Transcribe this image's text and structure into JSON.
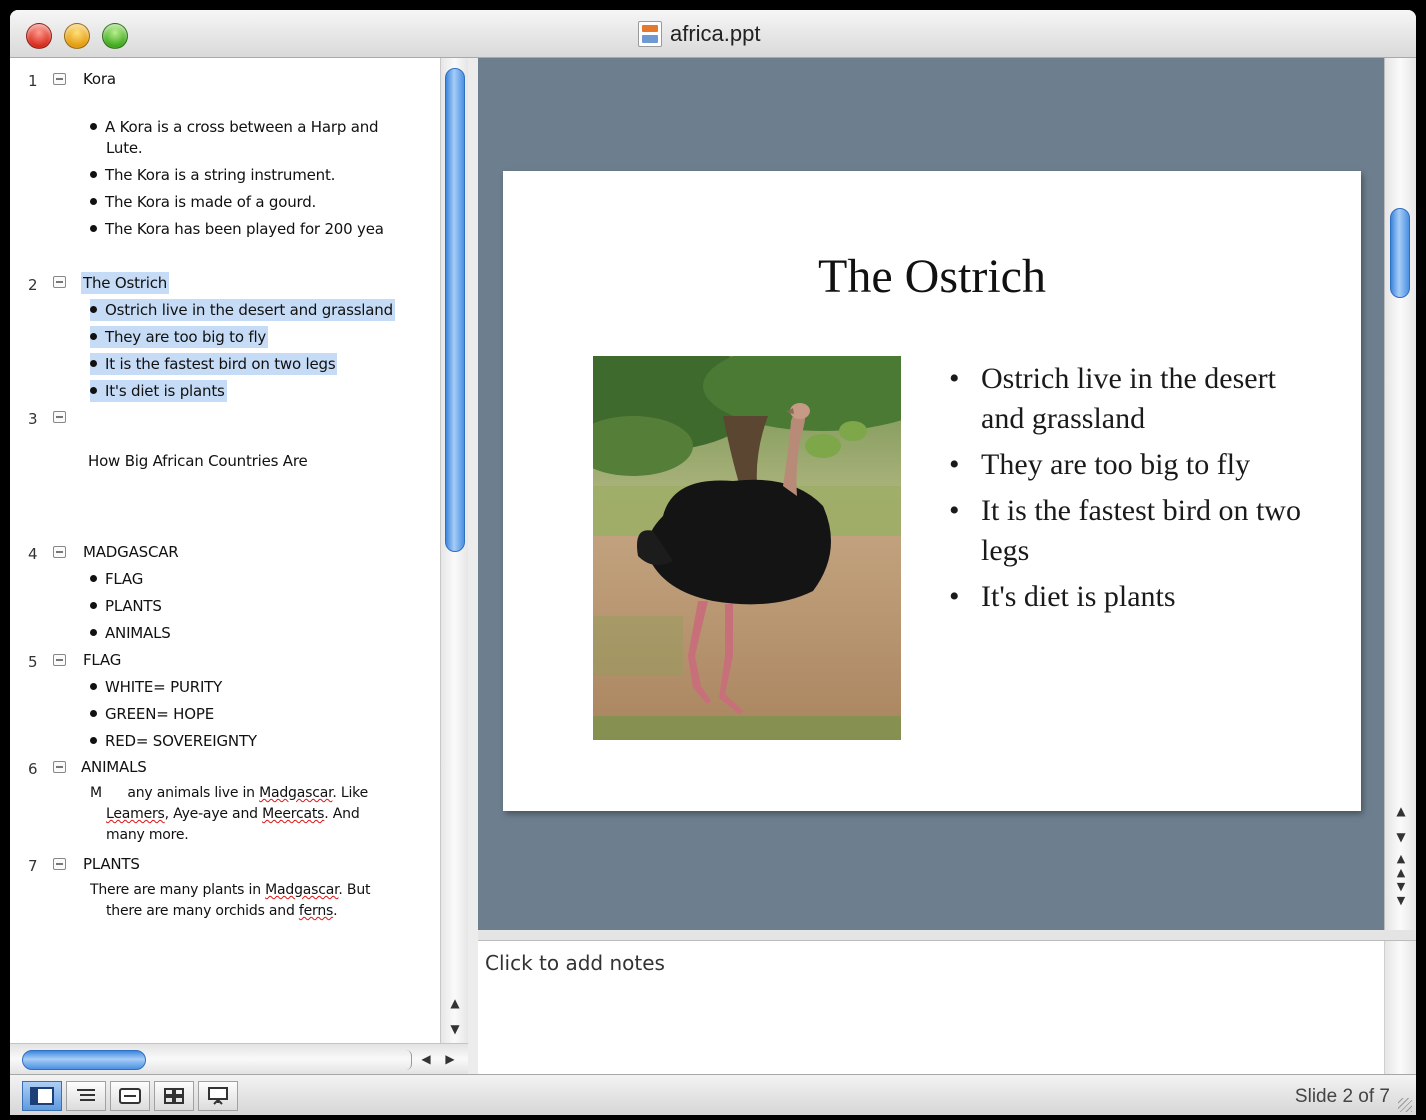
{
  "window": {
    "title": "africa.ppt"
  },
  "outline": {
    "slides": [
      {
        "num": "1",
        "title": "Kora",
        "bullets": [
          "A Kora is a cross between a Harp and",
          "Lute.",
          "The Kora is a string instrument.",
          "The Kora is made of a gourd.",
          "The Kora has been played for 200 yea"
        ]
      },
      {
        "num": "2",
        "title": "The Ostrich",
        "bullets": [
          "Ostrich live in the desert and grassland",
          "They are too big to fly",
          "It is the fastest bird on two legs",
          "It's diet is plants"
        ]
      },
      {
        "num": "3",
        "title": "",
        "body": "How Big African Countries Are"
      },
      {
        "num": "4",
        "title": "MADGASCAR",
        "bullets": [
          "FLAG",
          "PLANTS",
          "ANIMALS"
        ]
      },
      {
        "num": "5",
        "title": "FLAG",
        "bullets": [
          "WHITE= PURITY",
          "GREEN= HOPE",
          "RED= SOVEREIGNTY"
        ]
      },
      {
        "num": "6",
        "title": "ANIMALS",
        "body_lines": [
          "M      any animals live in Madgascar. Like",
          "Leamers, Aye-aye and Meercats. And",
          "many more."
        ]
      },
      {
        "num": "7",
        "title": "PLANTS",
        "body_lines": [
          "There are many plants in Madgascar. But",
          "there are many orchids and ferns."
        ]
      }
    ]
  },
  "slide": {
    "title": "The Ostrich",
    "bullets": [
      "Ostrich live in the desert and grassland",
      "They are too big to fly",
      "It is the fastest bird on two legs",
      "It's diet is plants"
    ],
    "image_alt": "ostrich-photo"
  },
  "notes": {
    "placeholder": "Click to add notes"
  },
  "status": {
    "slide_counter": "Slide 2 of 7"
  },
  "colors": {
    "selection": "#c6dcf6",
    "slide_bg": "#6d7f8f",
    "scroll_accent": "#3d86de"
  }
}
